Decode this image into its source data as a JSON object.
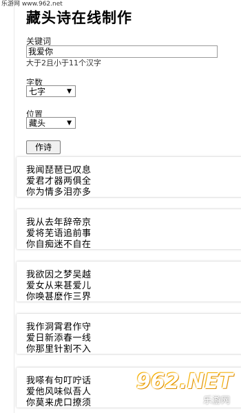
{
  "watermark_top": "乐游网 www.962.net",
  "title": "藏头诗在线制作",
  "keyword": {
    "label": "关键词",
    "value": "我爱你",
    "hint": "大于2且小于11个汉字"
  },
  "word_count": {
    "label": "字数",
    "selected": "七字"
  },
  "position": {
    "label": "位置",
    "selected": "藏头"
  },
  "submit_label": "作诗",
  "poems": [
    {
      "lines": [
        "我闻琵琶已叹息",
        "爱君才器两俱全",
        "你为情多泪亦多"
      ]
    },
    {
      "lines": [
        "我从去年辞帝京",
        "爱将芜语追前事",
        "你自痴迷不自在"
      ]
    },
    {
      "lines": [
        "我欲因之梦吴越",
        "爱女从来甚爱儿",
        "你唤甚麽作三界"
      ]
    },
    {
      "lines": [
        "我作洞霄君作守",
        "爱日新添春一线",
        "你那里针割不入"
      ]
    },
    {
      "lines": [
        "我嗏有句叮咛话",
        "爱他风味似吾人",
        "你莫来虎口撩须"
      ]
    }
  ],
  "logo": {
    "text": "962.NET",
    "sub": "乐游网"
  },
  "colors": {
    "accent": "#f0a000"
  }
}
